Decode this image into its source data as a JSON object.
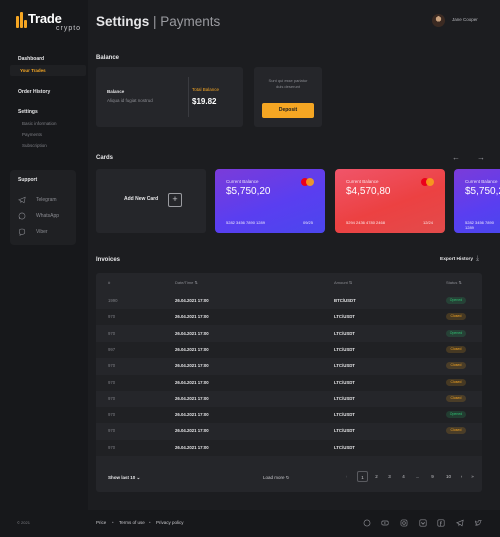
{
  "brand": {
    "name": "Trade",
    "tagline": "crypto"
  },
  "sidebar": {
    "dashboard": "Dashboard",
    "your_trades": "Your Trades",
    "order_history": "Order History",
    "settings": "Settings",
    "settings_items": [
      "Basic information",
      "Payments",
      "Subscription"
    ],
    "support": {
      "title": "Support",
      "items": [
        "Telegram",
        "WhatsApp",
        "Viber"
      ]
    }
  },
  "header": {
    "title_main": "Settings",
    "title_sep": " | ",
    "title_sub": "Payments",
    "user_name": "Jane Cooper"
  },
  "balance": {
    "section_title": "Balance",
    "label": "Balance",
    "desc": "Aliqua id fugiat nostrud",
    "total_label": "Total Balance",
    "total_value": "$19.82",
    "promo_text": "Sunt qui esse pariatur duis deserunt",
    "deposit_label": "Deposit"
  },
  "cards": {
    "section_title": "Cards",
    "prev_icon": "arrow-left-icon",
    "next_icon": "arrow-right-icon",
    "add_label": "Add New Card",
    "items": [
      {
        "label": "Current Balance",
        "amount": "$5,750,20",
        "number": "5282 3456 7890 1289",
        "expiry": "09/25",
        "brand": "Mastercard"
      },
      {
        "label": "Current Balance",
        "amount": "$4,570,80",
        "number": "5294 2436 4780 2468",
        "expiry": "12/24",
        "brand": "Mastercard"
      },
      {
        "label": "Current Balance",
        "amount": "$5,750,20",
        "number": "5282 3456 7890 1289",
        "expiry": "",
        "brand": "Mastercard"
      }
    ]
  },
  "invoices": {
    "section_title": "Invoices",
    "export_label": "Export History",
    "columns": [
      "#",
      "Date/Time",
      "Amount",
      "Status"
    ],
    "rows": [
      {
        "id": "1990",
        "datetime": "26.04.2021 17:00",
        "amount": "BTC/USDT",
        "status": "Opened"
      },
      {
        "id": "970",
        "datetime": "26.04.2021 17:00",
        "amount": "LTC/USDT",
        "status": "Closed"
      },
      {
        "id": "970",
        "datetime": "26.04.2021 17:00",
        "amount": "LTC/USDT",
        "status": "Opened"
      },
      {
        "id": "997",
        "datetime": "26.04.2021 17:00",
        "amount": "LTC/USDT",
        "status": "Closed"
      },
      {
        "id": "970",
        "datetime": "26.04.2021 17:00",
        "amount": "LTC/USDT",
        "status": "Closed"
      },
      {
        "id": "970",
        "datetime": "26.04.2021 17:00",
        "amount": "LTC/USDT",
        "status": "Closed"
      },
      {
        "id": "970",
        "datetime": "26.04.2021 17:00",
        "amount": "LTC/USDT",
        "status": "Closed"
      },
      {
        "id": "970",
        "datetime": "26.04.2021 17:00",
        "amount": "LTC/USDT",
        "status": "Opened"
      },
      {
        "id": "970",
        "datetime": "26.04.2021 17:00",
        "amount": "LTC/USDT",
        "status": "Closed"
      },
      {
        "id": "970",
        "datetime": "26.04.2021 17:00",
        "amount": "LTC/USDT",
        "status": ""
      }
    ],
    "show_last": "Show last 10",
    "load_more": "Load more",
    "pages": [
      "1",
      "2",
      "3",
      "4",
      "...",
      "9",
      "10"
    ]
  },
  "footer": {
    "copyright": "© 2021",
    "links": [
      "Price",
      "Terms of use",
      "Privacy policy"
    ],
    "social_icons": [
      "whatsapp-icon",
      "youtube-icon",
      "instagram-icon",
      "vk-icon",
      "facebook-icon",
      "telegram-icon",
      "twitter-icon"
    ]
  },
  "colors": {
    "accent": "#f5a623",
    "opened": "#2fbf71",
    "closed": "#f5a623",
    "card_purple": "#5b3ff0",
    "card_red": "#f04a4a"
  }
}
